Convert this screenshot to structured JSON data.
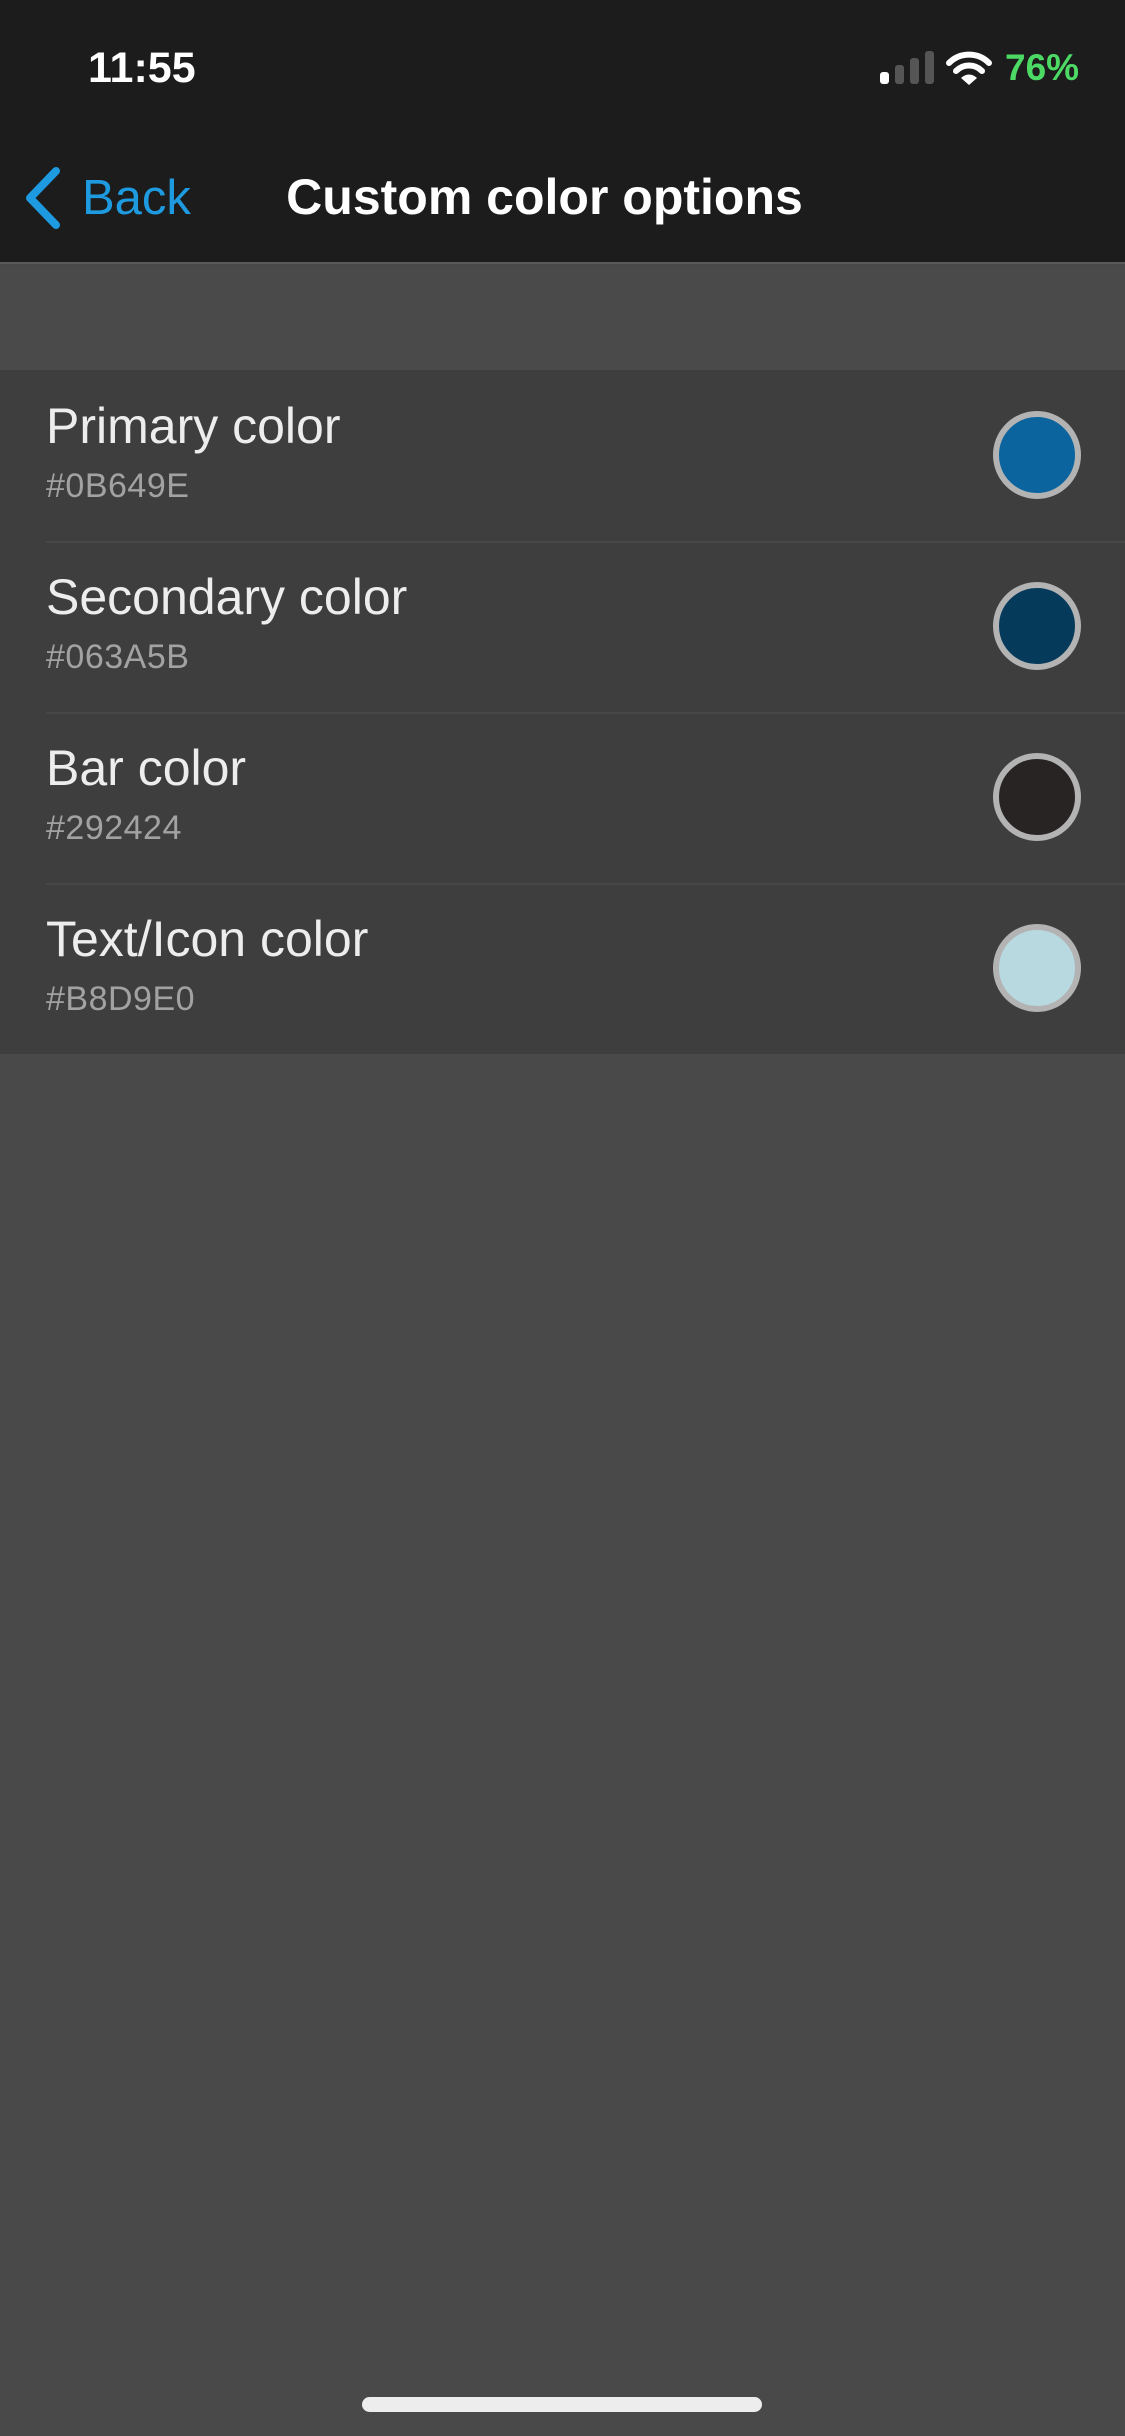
{
  "status_bar": {
    "time": "11:55",
    "signal_icon": "cellular-signal-icon",
    "signal_bars_active": 1,
    "signal_bars_total": 4,
    "wifi_icon": "wifi-icon",
    "battery_percent": "76%",
    "battery_color": "#4CD964"
  },
  "nav": {
    "back_icon": "chevron-left-icon",
    "back_label": "Back",
    "title": "Custom color options",
    "accent_color": "#1E9BE0"
  },
  "color_options": [
    {
      "label": "Primary color",
      "value": "#0B649E"
    },
    {
      "label": "Secondary color",
      "value": "#063A5B"
    },
    {
      "label": "Bar color",
      "value": "#292424"
    },
    {
      "label": "Text/Icon color",
      "value": "#B8D9E0"
    }
  ]
}
